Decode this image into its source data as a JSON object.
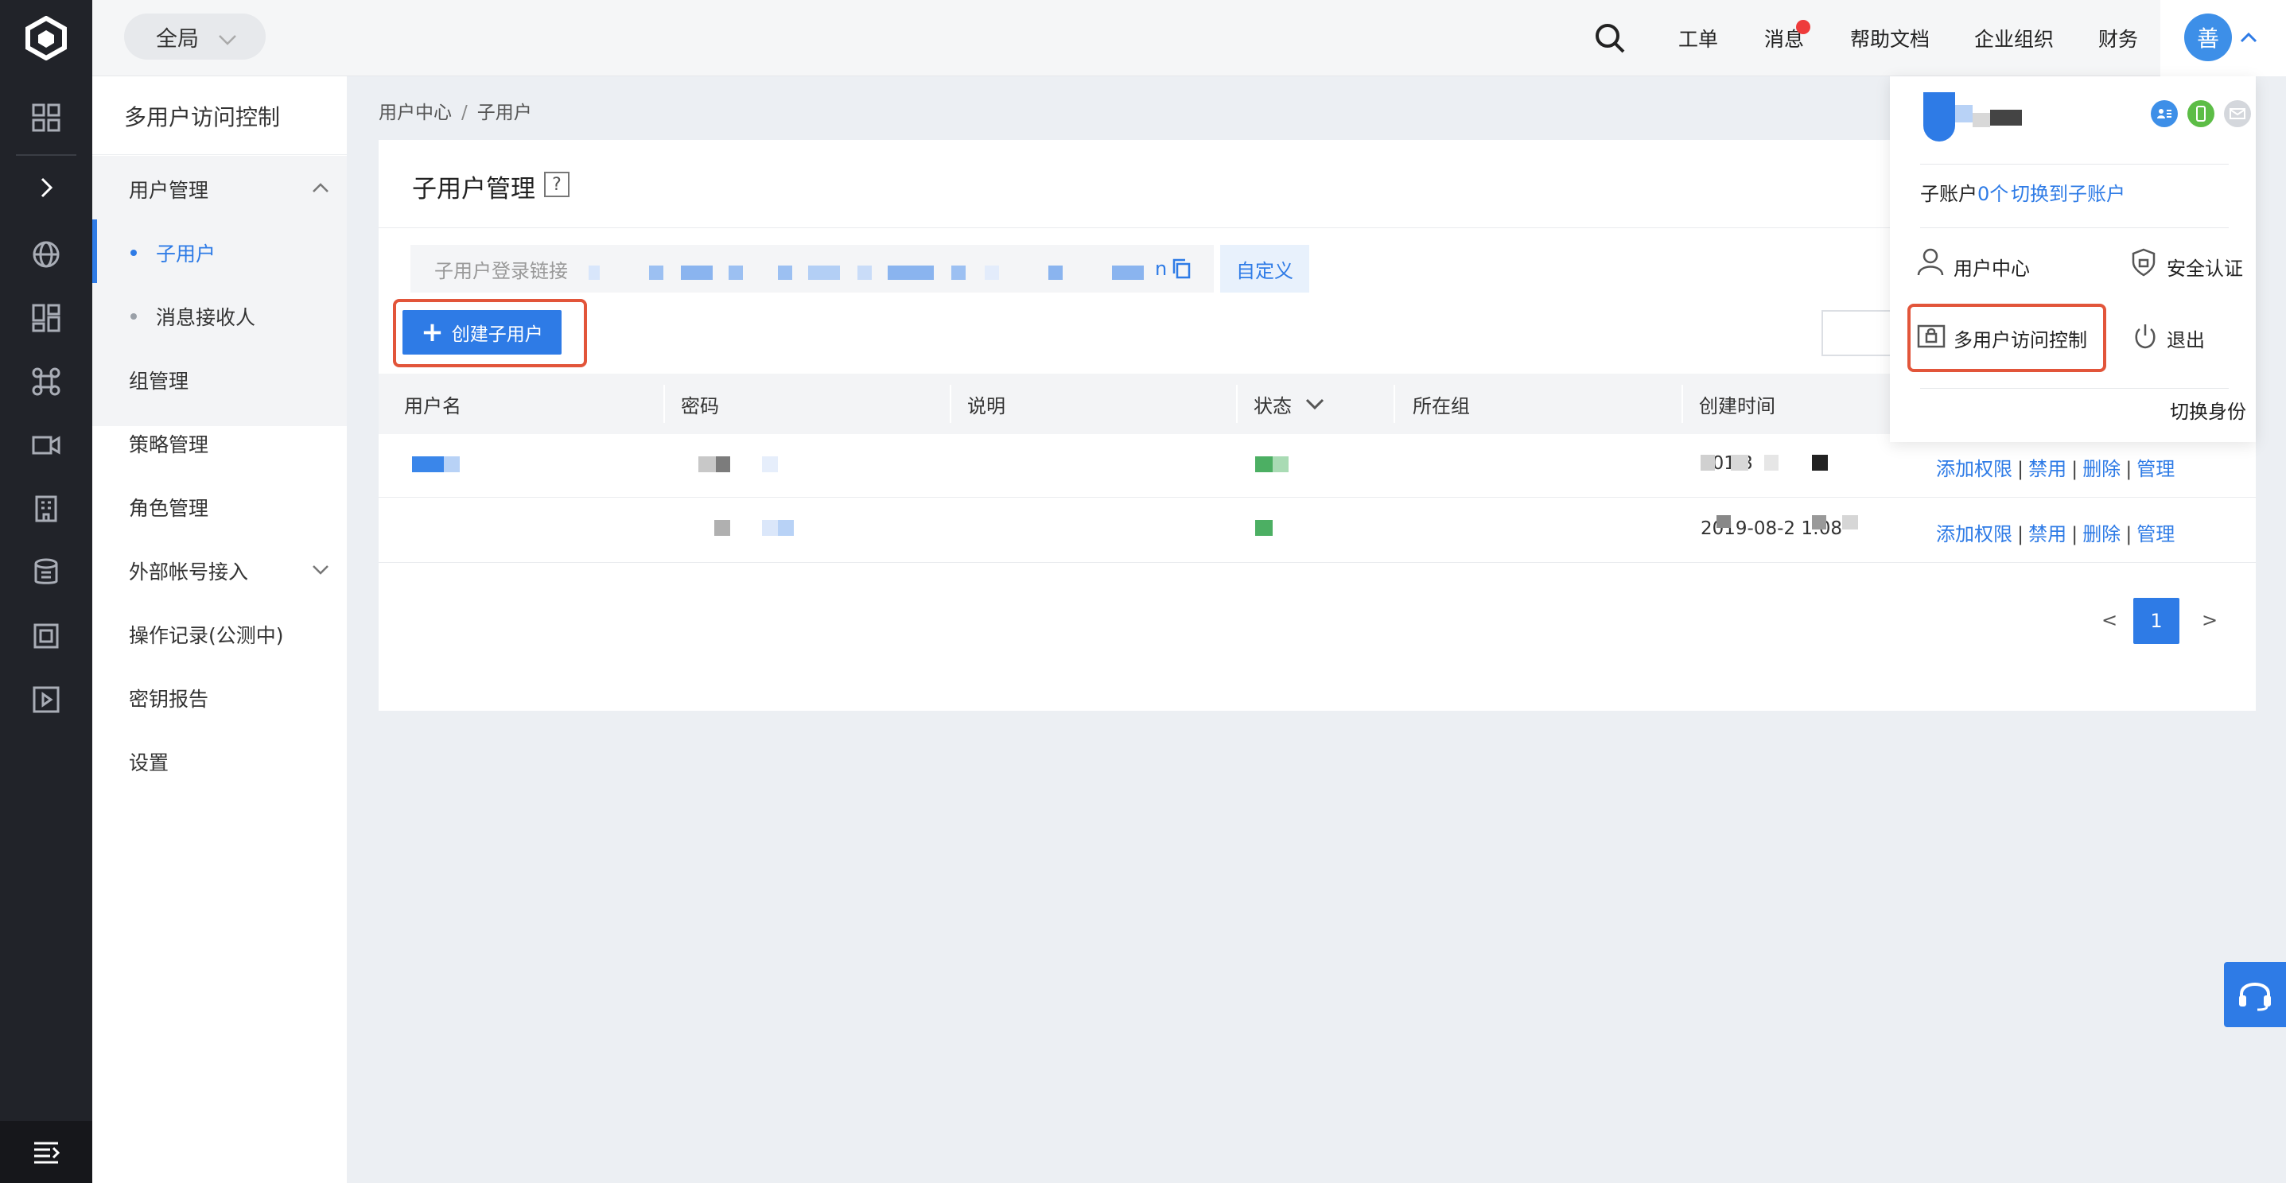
{
  "topbar": {
    "scope_label": "全局",
    "nav": [
      "工单",
      "消息",
      "帮助文档",
      "企业组织",
      "财务"
    ],
    "avatar_text": "善"
  },
  "sidebar": {
    "title": "多用户访问控制",
    "items": [
      {
        "label": "用户管理"
      },
      {
        "label": "子用户"
      },
      {
        "label": "消息接收人"
      },
      {
        "label": "组管理"
      },
      {
        "label": "策略管理"
      },
      {
        "label": "角色管理"
      },
      {
        "label": "外部帐号接入"
      },
      {
        "label": "操作记录(公测中)"
      },
      {
        "label": "密钥报告"
      },
      {
        "label": "设置"
      }
    ]
  },
  "breadcrumb": {
    "root": "用户中心",
    "current": "子用户"
  },
  "main": {
    "title": "子用户管理",
    "help_glyph": "?",
    "login_link_label": "子用户登录链接",
    "login_link_tail": "n",
    "custom_button": "自定义",
    "create_button": "创建子用户",
    "columns": [
      "用户名",
      "密码",
      "说明",
      "状态",
      "所在组",
      "创建时间"
    ],
    "rows": [
      {
        "created": "201  3",
        "actions": [
          "添加权限",
          "禁用",
          "删除",
          "管理"
        ]
      },
      {
        "created": "2019-08-2  1:08",
        "actions": [
          "添加权限",
          "禁用",
          "删除",
          "管理"
        ]
      }
    ],
    "pager": {
      "prev": "<",
      "current": "1",
      "next": ">"
    }
  },
  "dropdown": {
    "subaccount_prefix": "子账户",
    "subaccount_count": "0个",
    "switch_link": "切换到子账户",
    "user_center": "用户中心",
    "security": "安全认证",
    "multiuser": "多用户访问控制",
    "logout": "退出",
    "switch_identity": "切换身份"
  },
  "colors": {
    "accent": "#2e7be6",
    "highlight_border": "#e2553a",
    "rail_bg": "#212329",
    "status_green": "#4caf63",
    "notification_dot": "#ee3b3b"
  }
}
